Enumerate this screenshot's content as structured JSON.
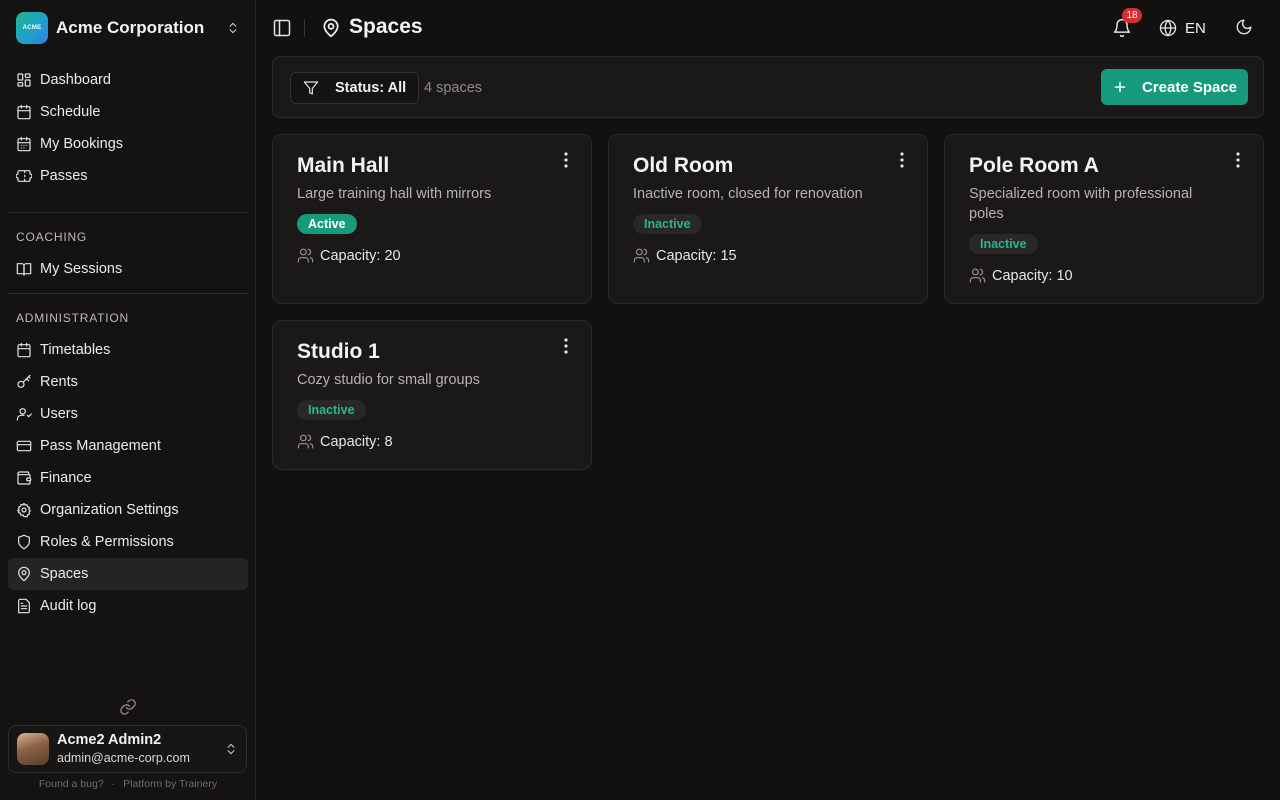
{
  "org": {
    "name": "Acme Corporation",
    "logo_text": "ACME"
  },
  "nav": {
    "main": [
      {
        "label": "Dashboard",
        "icon": "dashboard-icon"
      },
      {
        "label": "Schedule",
        "icon": "calendar-icon"
      },
      {
        "label": "My Bookings",
        "icon": "bookings-icon"
      },
      {
        "label": "Passes",
        "icon": "ticket-icon"
      }
    ],
    "coaching_label": "Coaching",
    "coaching": [
      {
        "label": "My Sessions",
        "icon": "book-icon"
      }
    ],
    "administration_label": "Administration",
    "administration": [
      {
        "label": "Timetables",
        "icon": "calendar-icon"
      },
      {
        "label": "Rents",
        "icon": "key-icon"
      },
      {
        "label": "Users",
        "icon": "users-icon"
      },
      {
        "label": "Pass Management",
        "icon": "ticket-icon"
      },
      {
        "label": "Finance",
        "icon": "wallet-icon"
      },
      {
        "label": "Organization Settings",
        "icon": "gear-icon"
      },
      {
        "label": "Roles & Permissions",
        "icon": "shield-icon"
      },
      {
        "label": "Spaces",
        "icon": "map-pin-icon",
        "active": true
      },
      {
        "label": "Audit log",
        "icon": "audit-icon"
      }
    ]
  },
  "user": {
    "name": "Acme2 Admin2",
    "email": "admin@acme-corp.com"
  },
  "footer": {
    "bug": "Found a bug?",
    "platform": "Platform by Trainery"
  },
  "header": {
    "title": "Spaces",
    "notifications": "18",
    "language": "EN"
  },
  "toolbar": {
    "filter_label": "Status: All",
    "count": "4 spaces",
    "create_label": "Create Space"
  },
  "spaces": [
    {
      "name": "Main Hall",
      "description": "Large training hall with mirrors",
      "status": "Active",
      "capacity": "Capacity: 20"
    },
    {
      "name": "Old Room",
      "description": "Inactive room, closed for renovation",
      "status": "Inactive",
      "capacity": "Capacity: 15"
    },
    {
      "name": "Pole Room A",
      "description": "Specialized room with professional poles",
      "status": "Inactive",
      "capacity": "Capacity: 10"
    },
    {
      "name": "Studio 1",
      "description": "Cozy studio for small groups",
      "status": "Inactive",
      "capacity": "Capacity: 8"
    }
  ],
  "colors": {
    "accent": "#17997b",
    "background": "#121110",
    "card": "#1a1918",
    "badge": "#d92d2d"
  }
}
